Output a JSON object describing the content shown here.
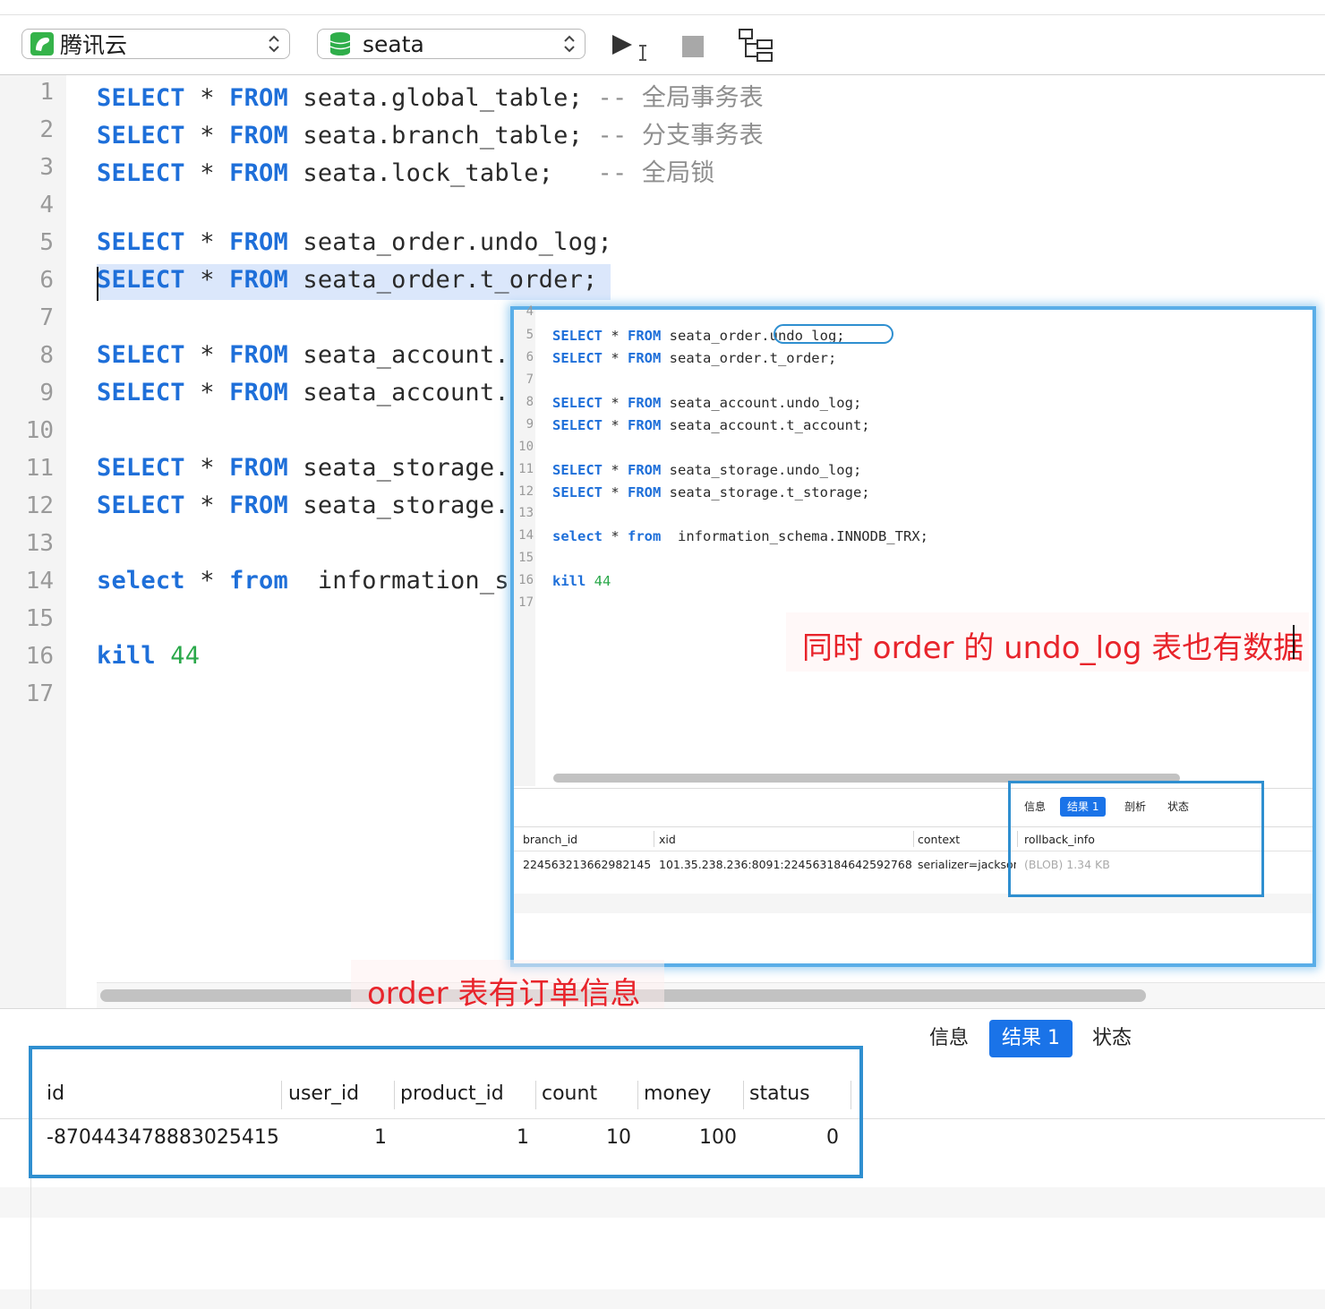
{
  "toolbar": {
    "connection": "腾讯云",
    "database": "seata",
    "connection_icon": "elephant-icon",
    "database_icon": "database-icon",
    "run_icon": "run-icon",
    "stop_icon": "stop-icon",
    "explain_icon": "explain-icon"
  },
  "editor": {
    "line_numbers": [
      "1",
      "2",
      "3",
      "4",
      "5",
      "6",
      "7",
      "8",
      "9",
      "10",
      "11",
      "12",
      "13",
      "14",
      "15",
      "16",
      "17"
    ],
    "lines": [
      {
        "kw1": "SELECT",
        "op": " * ",
        "kw2": "FROM",
        "rest": " seata.global_table; ",
        "comment": "-- 全局事务表"
      },
      {
        "kw1": "SELECT",
        "op": " * ",
        "kw2": "FROM",
        "rest": " seata.branch_table; ",
        "comment": "-- 分支事务表"
      },
      {
        "kw1": "SELECT",
        "op": " * ",
        "kw2": "FROM",
        "rest": " seata.lock_table;   ",
        "comment": "-- 全局锁"
      },
      {
        "kw1": "SELECT",
        "op": " * ",
        "kw2": "FROM",
        "rest": " seata_order.undo_log;"
      },
      {
        "kw1": "SELECT",
        "op": " * ",
        "kw2": "FROM",
        "rest": " seata_order.t_order;"
      },
      {
        "kw1": "SELECT",
        "op": " * ",
        "kw2": "FROM",
        "rest": " seata_account."
      },
      {
        "kw1": "SELECT",
        "op": " * ",
        "kw2": "FROM",
        "rest": " seata_account."
      },
      {
        "kw1": "SELECT",
        "op": " * ",
        "kw2": "FROM",
        "rest": " seata_storage."
      },
      {
        "kw1": "SELECT",
        "op": " * ",
        "kw2": "FROM",
        "rest": " seata_storage."
      },
      {
        "kw1": "select",
        "op": " * ",
        "kw2": "from",
        "rest": "  information_s"
      },
      {
        "kw1": "kill",
        "num": "44"
      }
    ]
  },
  "annotations": {
    "order_note": "order 表有订单信息",
    "undo_note": "同时 order 的 undo_log 表也有数据"
  },
  "results": {
    "tabs": [
      "信息",
      "结果 1",
      "状态"
    ],
    "active_tab": "结果 1",
    "columns": [
      "id",
      "user_id",
      "product_id",
      "count",
      "money",
      "status"
    ],
    "rows": [
      [
        "-870443478883025415",
        "1",
        "1",
        "10",
        "100",
        "0"
      ]
    ]
  },
  "inset": {
    "line_numbers": [
      "4",
      "5",
      "6",
      "7",
      "8",
      "9",
      "10",
      "11",
      "12",
      "13",
      "14",
      "15",
      "16",
      "17"
    ],
    "lines": [
      {
        "kw1": "SELECT",
        "op": " * ",
        "kw2": "FROM",
        "rest": " seata_order.undo_log;"
      },
      {
        "kw1": "SELECT",
        "op": " * ",
        "kw2": "FROM",
        "rest": " seata_order.t_order;"
      },
      {
        "kw1": "SELECT",
        "op": " * ",
        "kw2": "FROM",
        "rest": " seata_account.undo_log;"
      },
      {
        "kw1": "SELECT",
        "op": " * ",
        "kw2": "FROM",
        "rest": " seata_account.t_account;"
      },
      {
        "kw1": "SELECT",
        "op": " * ",
        "kw2": "FROM",
        "rest": " seata_storage.undo_log;"
      },
      {
        "kw1": "SELECT",
        "op": " * ",
        "kw2": "FROM",
        "rest": " seata_storage.t_storage;"
      },
      {
        "kw1": "select",
        "op": " * ",
        "kw2": "from",
        "rest": "  information_schema.INNODB_TRX;"
      },
      {
        "kw1": "kill",
        "num": "44"
      }
    ],
    "tabs": [
      "信息",
      "结果 1",
      "剖析",
      "状态"
    ],
    "active_tab": "结果 1",
    "columns": [
      "branch_id",
      "xid",
      "context",
      "rollback_info"
    ],
    "row": [
      "224563213662982145",
      "101.35.238.236:8091:224563184642592768",
      "serializer=jackson",
      "(BLOB) 1.34 KB"
    ]
  },
  "colors": {
    "keyword": "#1e6fd9",
    "number": "#2aa84a",
    "accent": "#1a73e8",
    "annotation": "#e8242b",
    "box": "#2f8fd0"
  }
}
